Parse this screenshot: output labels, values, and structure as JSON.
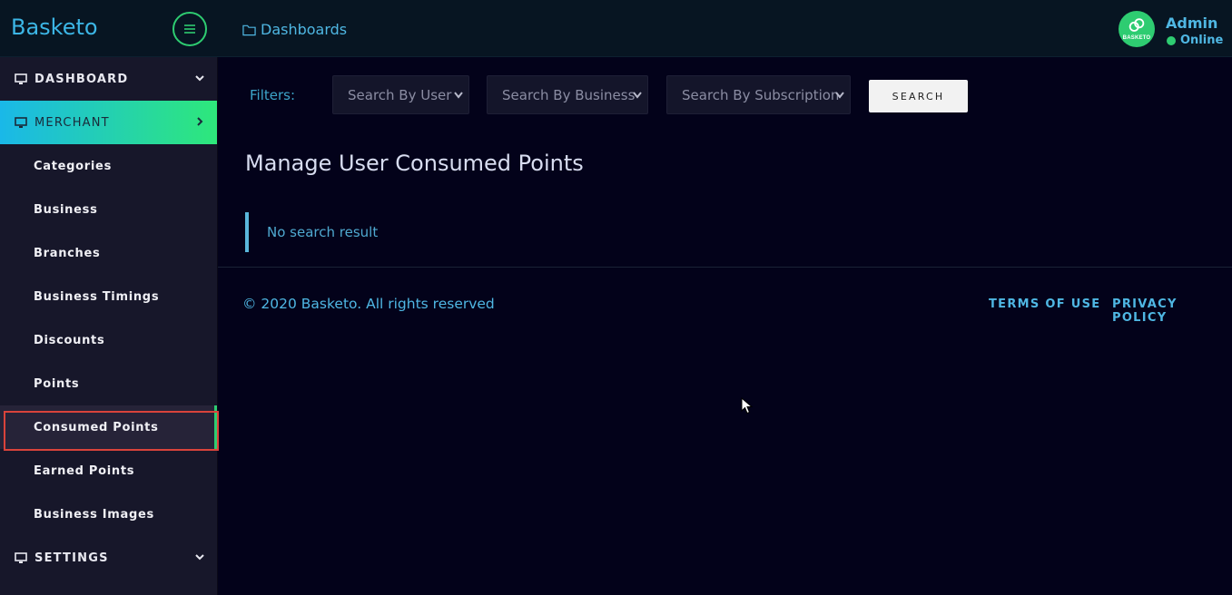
{
  "header": {
    "brand": "Basketo",
    "breadcrumb": "Dashboards",
    "avatar_text": "BASKETO",
    "user_name": "Admin",
    "user_status": "Online"
  },
  "sidebar": {
    "sections": [
      {
        "label": "DASHBOARD",
        "icon": "monitor-icon",
        "chevron": "chevron-down-icon"
      },
      {
        "label": "MERCHANT",
        "icon": "monitor-icon",
        "chevron": "chevron-right-icon",
        "active": true
      },
      {
        "label": "SETTINGS",
        "icon": "monitor-icon",
        "chevron": "chevron-down-icon"
      }
    ],
    "items": [
      {
        "label": "Categories"
      },
      {
        "label": "Business"
      },
      {
        "label": "Branches"
      },
      {
        "label": "Business Timings"
      },
      {
        "label": "Discounts"
      },
      {
        "label": "Points"
      },
      {
        "label": "Consumed Points",
        "selected": true
      },
      {
        "label": "Earned Points"
      },
      {
        "label": "Business Images"
      }
    ]
  },
  "filters": {
    "label": "Filters:",
    "user_select": "Search By User",
    "business_select": "Search By Business",
    "subscription_select": "Search By Subscription",
    "search_button": "SEARCH"
  },
  "main": {
    "title": "Manage User Consumed Points",
    "notice": "No search result"
  },
  "footer": {
    "copyright": "© 2020 Basketo. All rights reserved",
    "terms": "TERMS OF USE",
    "privacy": "PRIVACY POLICY"
  },
  "colors": {
    "accent": "#4fb7e3",
    "online": "#2ecc71",
    "background": "#03021a",
    "sidebar": "#17172a",
    "highlight": "#d9433b"
  }
}
